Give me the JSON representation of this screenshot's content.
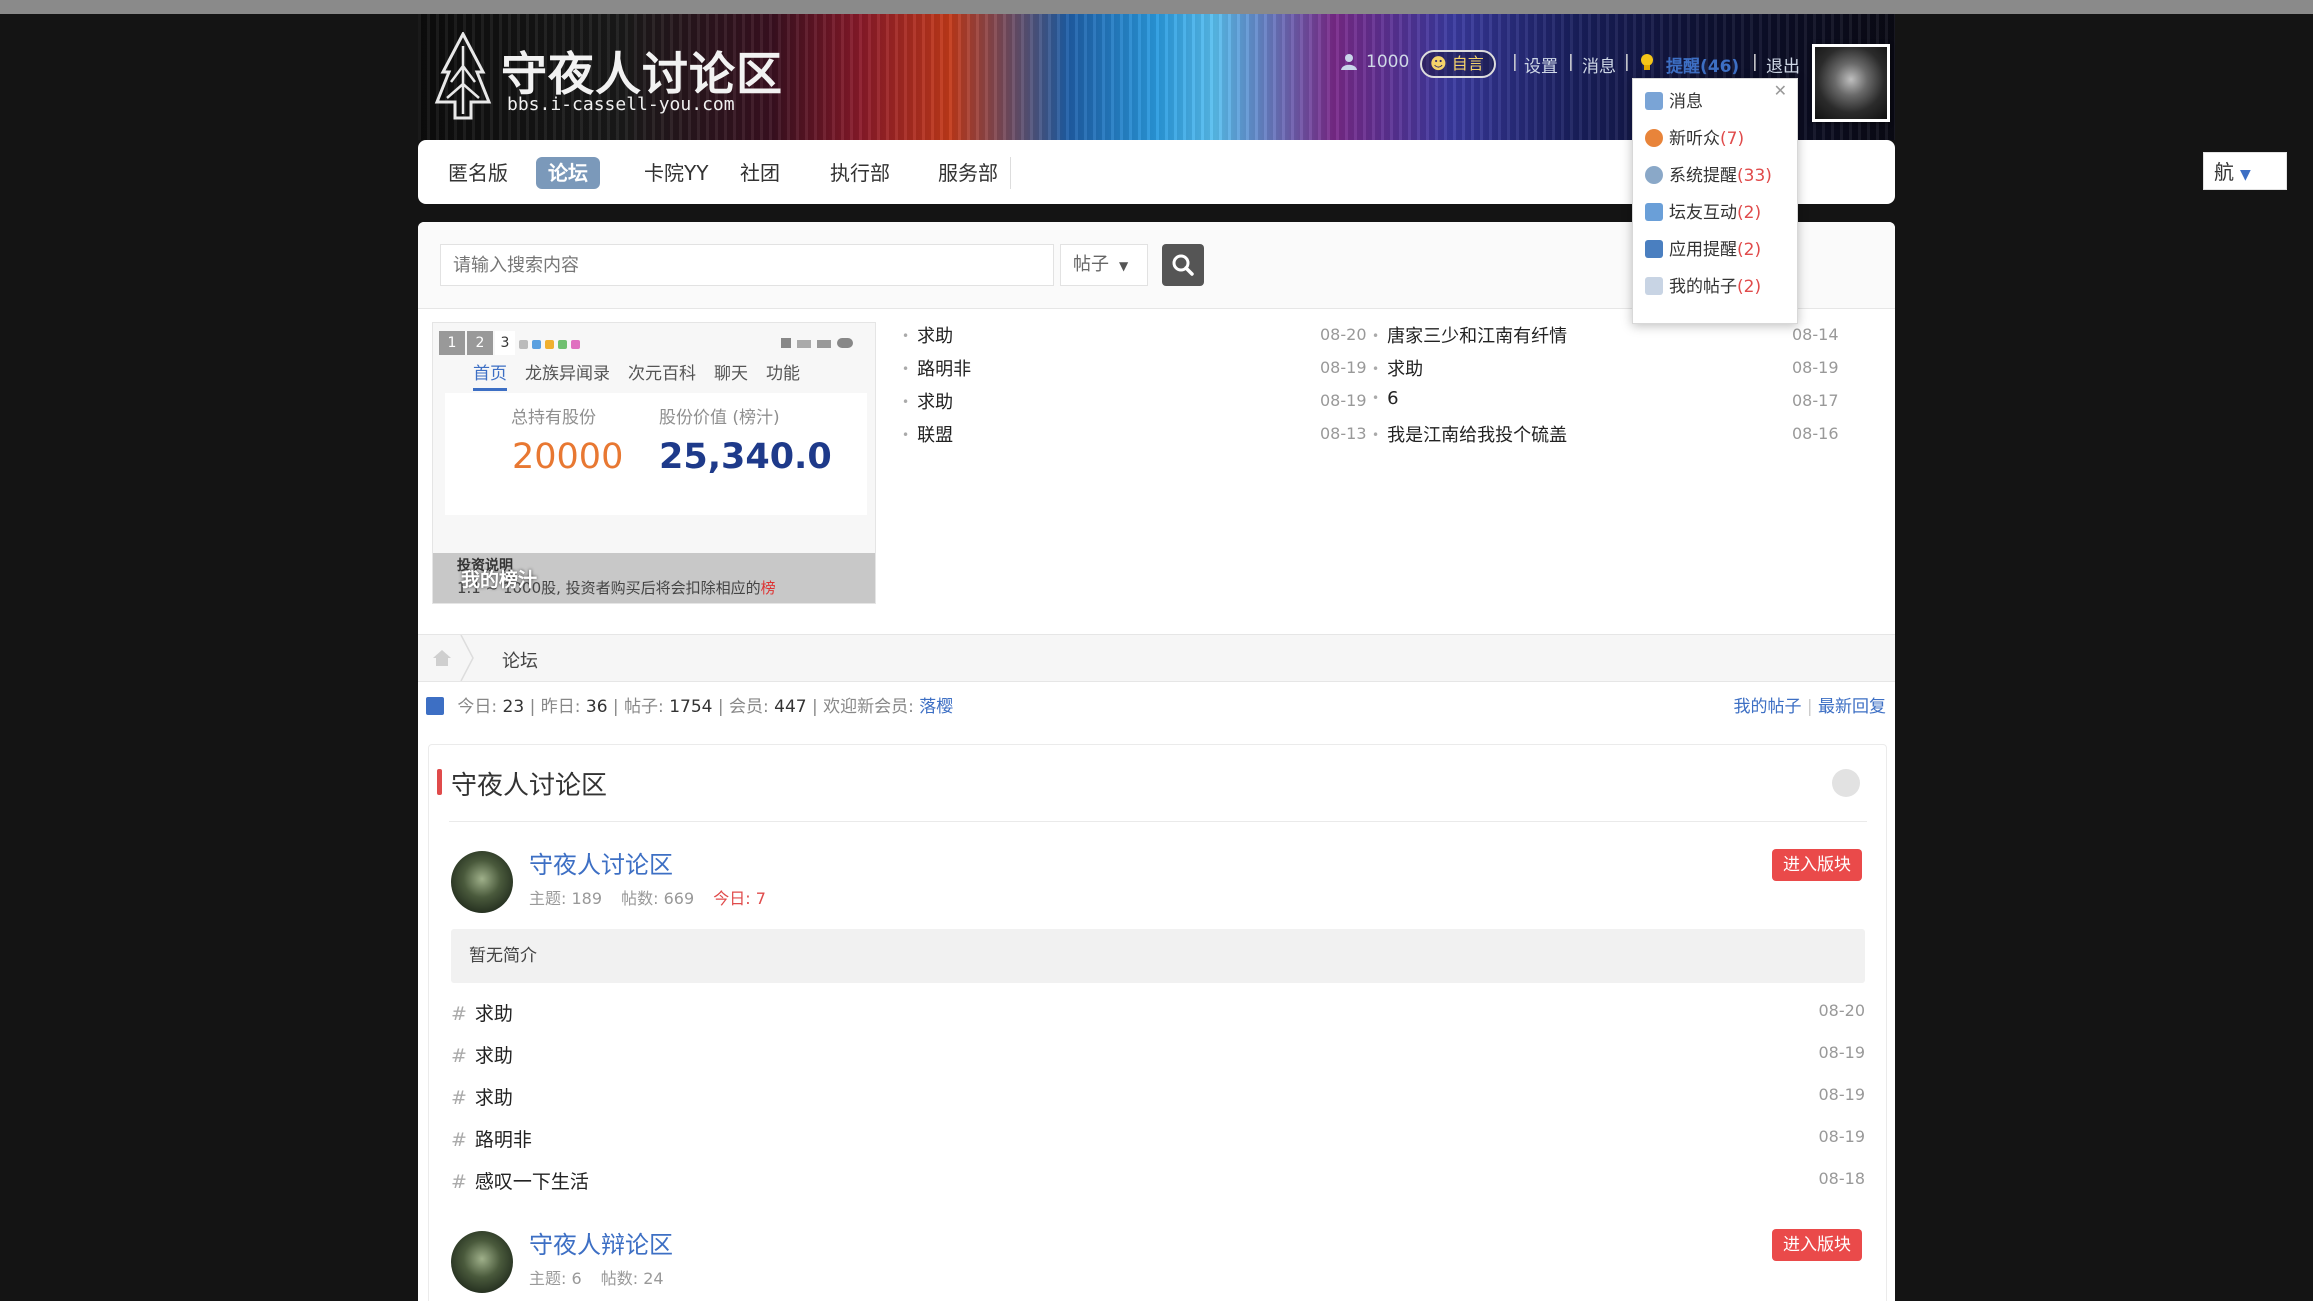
{
  "top_strip": "",
  "header": {
    "logo_title": "守夜人讨论区",
    "logo_url": "bbs.i-cassell-you.com",
    "userbar": {
      "username": "1000",
      "pill_label": "自言",
      "settings": "设置",
      "messages": "消息",
      "remind": "提醒(46)",
      "logout": "退出"
    }
  },
  "nav": {
    "items": [
      "匿名版",
      "论坛",
      "卡院YY",
      "社团",
      "执行部",
      "服务部"
    ],
    "active_index": 1,
    "site_nav_label": "航"
  },
  "search": {
    "placeholder": "请输入搜索内容",
    "type_selected": "帖子"
  },
  "widget": {
    "page_buttons": [
      "1",
      "2",
      "3"
    ],
    "tabs": [
      "首页",
      "龙族异闻录",
      "次元百科",
      "聊天",
      "功能"
    ],
    "active_tab": 0,
    "label_holdings": "总持有股份",
    "label_value": "股份价值 (榜汁)",
    "holdings": "20000",
    "value": "25,340.0",
    "note_title": "投资说明",
    "note_line": "1.1 ~ 1000股, 投资者购买后将会扣除相应的",
    "note_line_red": "榜",
    "overlay": "我的榜汁"
  },
  "latest_posts": {
    "left": [
      {
        "title": "求助",
        "date": "08-20"
      },
      {
        "title": "路明非",
        "date": "08-19"
      },
      {
        "title": "求助",
        "date": "08-19"
      },
      {
        "title": "联盟",
        "date": "08-13"
      }
    ],
    "right": [
      {
        "title": "唐家三少和江南有纤情",
        "date": "08-14"
      },
      {
        "title": "求助",
        "date": "08-19"
      },
      {
        "title": "6",
        "date": "08-17"
      },
      {
        "title": "我是江南给我投个硫盖",
        "date": "08-16"
      }
    ]
  },
  "breadcrumb": {
    "current": "论坛"
  },
  "stats": {
    "today_label": "今日:",
    "today": "23",
    "yesterday_label": "昨日:",
    "yesterday": "36",
    "posts_label": "帖子:",
    "posts": "1754",
    "members_label": "会员:",
    "members": "447",
    "welcome_label": "欢迎新会员:",
    "new_member": "落樱",
    "my_posts": "我的帖子",
    "latest_reply": "最新回复"
  },
  "forum_section": {
    "title": "守夜人讨论区",
    "boards": [
      {
        "name": "守夜人讨论区",
        "topics": "主题: 189",
        "posts": "帖数: 669",
        "today": "今日: 7",
        "enter": "进入版块",
        "intro": "暂无简介",
        "threads": [
          {
            "title": "求助",
            "date": "08-20"
          },
          {
            "title": "求助",
            "date": "08-19"
          },
          {
            "title": "求助",
            "date": "08-19"
          },
          {
            "title": "路明非",
            "date": "08-19"
          },
          {
            "title": "感叹一下生活",
            "date": "08-18"
          }
        ]
      },
      {
        "name": "守夜人辩论区",
        "topics": "主题: 6",
        "posts": "帖数: 24",
        "enter": "进入版块"
      }
    ]
  },
  "remind_dropdown": {
    "items": [
      {
        "label": "消息",
        "count": ""
      },
      {
        "label": "新听众",
        "count": "(7)"
      },
      {
        "label": "系统提醒",
        "count": "(33)"
      },
      {
        "label": "坛友互动",
        "count": "(2)"
      },
      {
        "label": "应用提醒",
        "count": "(2)"
      },
      {
        "label": "我的帖子",
        "count": "(2)"
      }
    ]
  },
  "colors": {
    "accent_blue": "#3d6fc4",
    "nav_active": "#7b99ba",
    "enter_red": "#ea4a4a",
    "holdings_orange": "#e87832",
    "value_navy": "#1e3a8a"
  }
}
